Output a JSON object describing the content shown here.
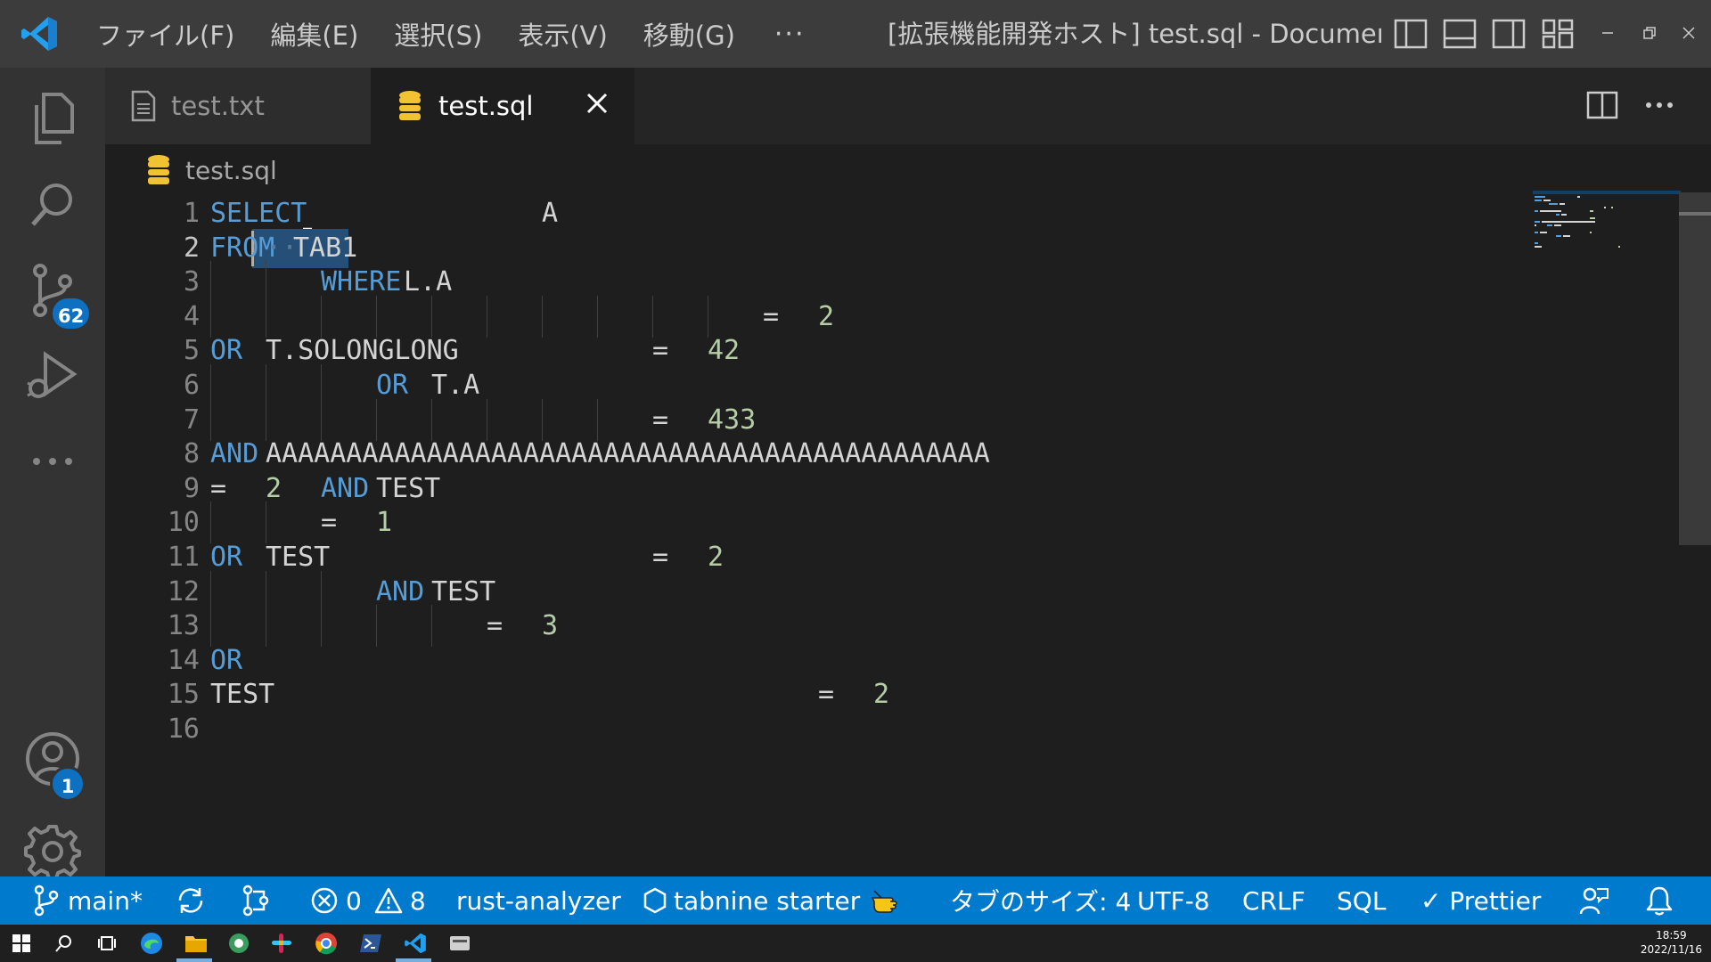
{
  "titlebar": {
    "menus": [
      "ファイル(F)",
      "編集(E)",
      "選択(S)",
      "表示(V)",
      "移動(G)"
    ],
    "more": "···",
    "window_title": "[拡張機能開発ホスト] test.sql - Document..."
  },
  "activitybar": {
    "source_control_badge": "62",
    "accounts_badge": "1"
  },
  "tabs": [
    {
      "label": "test.txt",
      "icon": "file-text-icon"
    },
    {
      "label": "test.sql",
      "icon": "database-icon"
    }
  ],
  "breadcrumb": {
    "file": "test.sql"
  },
  "editor": {
    "lines": [
      {
        "num": "1",
        "tokens": [
          {
            "t": "SELECT",
            "c": "kw",
            "col": 0
          },
          {
            "t": "A",
            "c": "id",
            "col": 24
          }
        ]
      },
      {
        "num": "2",
        "tokens": [
          {
            "t": "FROM",
            "c": "kw",
            "col": 0
          },
          {
            "t": "··",
            "c": "ws",
            "col": 4
          },
          {
            "t": "TAB1",
            "c": "id",
            "col": 6
          }
        ]
      },
      {
        "num": "3",
        "tokens": [
          {
            "t": "WHERE",
            "c": "kw",
            "col": 8
          },
          {
            "t": "L.A",
            "c": "id",
            "col": 14
          }
        ]
      },
      {
        "num": "4",
        "tokens": [
          {
            "t": "=",
            "c": "op",
            "col": 40
          },
          {
            "t": "2",
            "c": "num",
            "col": 44
          }
        ]
      },
      {
        "num": "5",
        "tokens": [
          {
            "t": "OR",
            "c": "kw",
            "col": 0
          },
          {
            "t": "T.SOLONGLONG",
            "c": "id",
            "col": 4
          },
          {
            "t": "=",
            "c": "op",
            "col": 32
          },
          {
            "t": "42",
            "c": "num",
            "col": 36
          }
        ]
      },
      {
        "num": "6",
        "tokens": [
          {
            "t": "OR",
            "c": "kw",
            "col": 12
          },
          {
            "t": "T.A",
            "c": "id",
            "col": 16
          }
        ]
      },
      {
        "num": "7",
        "tokens": [
          {
            "t": "=",
            "c": "op",
            "col": 32
          },
          {
            "t": "433",
            "c": "num",
            "col": 36
          }
        ]
      },
      {
        "num": "8",
        "tokens": [
          {
            "t": "AND",
            "c": "kw",
            "col": 0
          },
          {
            "t": "AAAAAAAAAAAAAAAAAAAAAAAAAAAAAAAAAAAAAAAAAAAAA",
            "c": "id",
            "col": 4
          }
        ]
      },
      {
        "num": "9",
        "tokens": [
          {
            "t": "=",
            "c": "op",
            "col": 0
          },
          {
            "t": "2",
            "c": "num",
            "col": 4
          },
          {
            "t": "AND",
            "c": "kw",
            "col": 8
          },
          {
            "t": "TEST",
            "c": "id",
            "col": 12
          }
        ]
      },
      {
        "num": "10",
        "tokens": [
          {
            "t": "=",
            "c": "op",
            "col": 8
          },
          {
            "t": "1",
            "c": "num",
            "col": 12
          }
        ]
      },
      {
        "num": "11",
        "tokens": [
          {
            "t": "OR",
            "c": "kw",
            "col": 0
          },
          {
            "t": "TEST",
            "c": "id",
            "col": 4
          },
          {
            "t": "=",
            "c": "op",
            "col": 32
          },
          {
            "t": "2",
            "c": "num",
            "col": 36
          }
        ]
      },
      {
        "num": "12",
        "tokens": [
          {
            "t": "AND",
            "c": "kw",
            "col": 12
          },
          {
            "t": "TEST",
            "c": "id",
            "col": 16
          }
        ]
      },
      {
        "num": "13",
        "tokens": [
          {
            "t": "=",
            "c": "op",
            "col": 20
          },
          {
            "t": "3",
            "c": "num",
            "col": 24
          }
        ]
      },
      {
        "num": "14",
        "tokens": [
          {
            "t": "OR",
            "c": "kw",
            "col": 0
          }
        ]
      },
      {
        "num": "15",
        "tokens": [
          {
            "t": "TEST",
            "c": "id",
            "col": 0
          },
          {
            "t": "=",
            "c": "op",
            "col": 44
          },
          {
            "t": "2",
            "c": "num",
            "col": 48
          }
        ]
      },
      {
        "num": "16",
        "tokens": []
      }
    ],
    "current_line": "2"
  },
  "statusbar": {
    "branch": "main*",
    "errors": "0",
    "warnings": "8",
    "rust_analyzer": "rust-analyzer",
    "tabnine": "tabnine starter",
    "tab_size": "タブのサイズ: 4",
    "encoding": "UTF-8",
    "eol": "CRLF",
    "language": "SQL",
    "prettier": "✓ Prettier"
  },
  "taskbar": {
    "time": "18:59",
    "date": "2022/11/16"
  },
  "colors": {
    "keyword": "#569cd6",
    "identifier": "#d4d4d4",
    "number": "#b5cea8",
    "statusbar": "#007acc",
    "selection": "#264f78"
  }
}
